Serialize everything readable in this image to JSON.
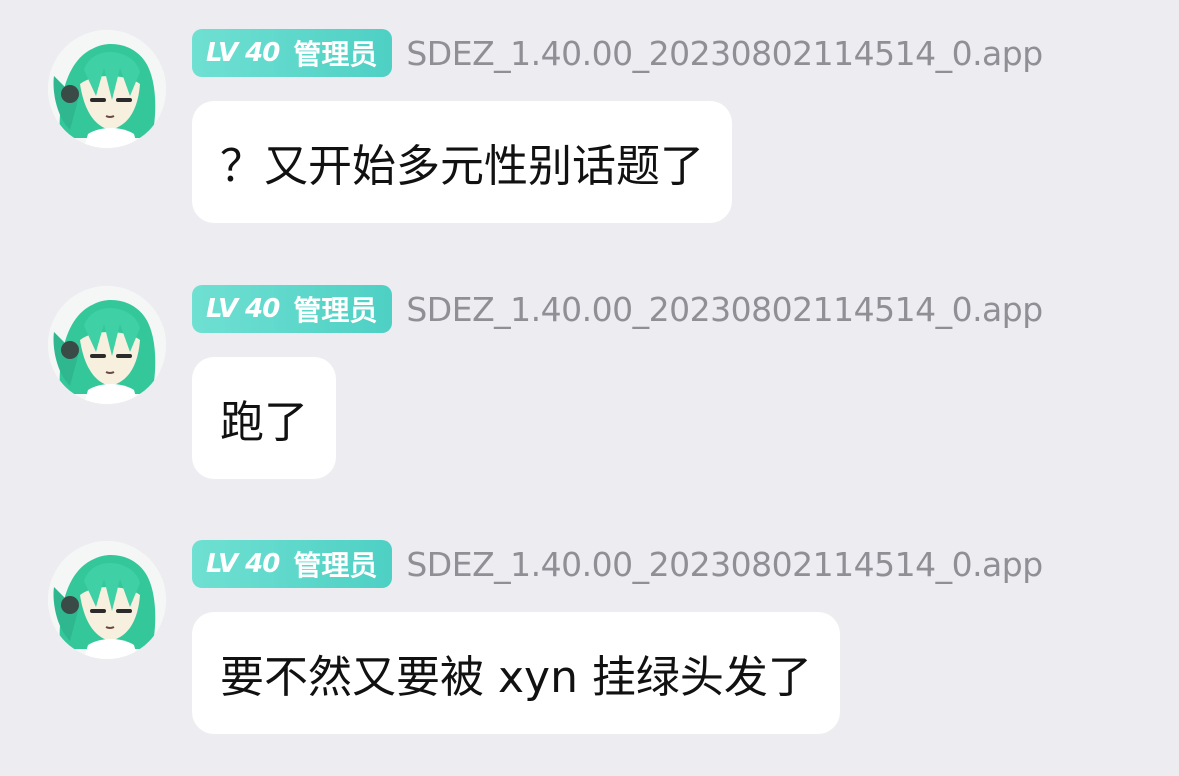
{
  "messages": [
    {
      "sender": {
        "level": "LV 40",
        "role": "管理员",
        "username": "SDEZ_1.40.00_20230802114514_0.app",
        "avatar_icon": "green-hair-anime-avatar-icon"
      },
      "text": "？又开始多元性别话题了"
    },
    {
      "sender": {
        "level": "LV 40",
        "role": "管理员",
        "username": "SDEZ_1.40.00_20230802114514_0.app",
        "avatar_icon": "green-hair-anime-avatar-icon"
      },
      "text": "跑了"
    },
    {
      "sender": {
        "level": "LV 40",
        "role": "管理员",
        "username": "SDEZ_1.40.00_20230802114514_0.app",
        "avatar_icon": "green-hair-anime-avatar-icon"
      },
      "text": "要不然又要被 xyn 挂绿头发了"
    }
  ],
  "colors": {
    "background": "#ececf1",
    "badge": "#5fd8cb",
    "username": "#8f8f95",
    "bubble": "#ffffff",
    "message_text": "#111111",
    "avatar_hair": "#34c79a"
  }
}
